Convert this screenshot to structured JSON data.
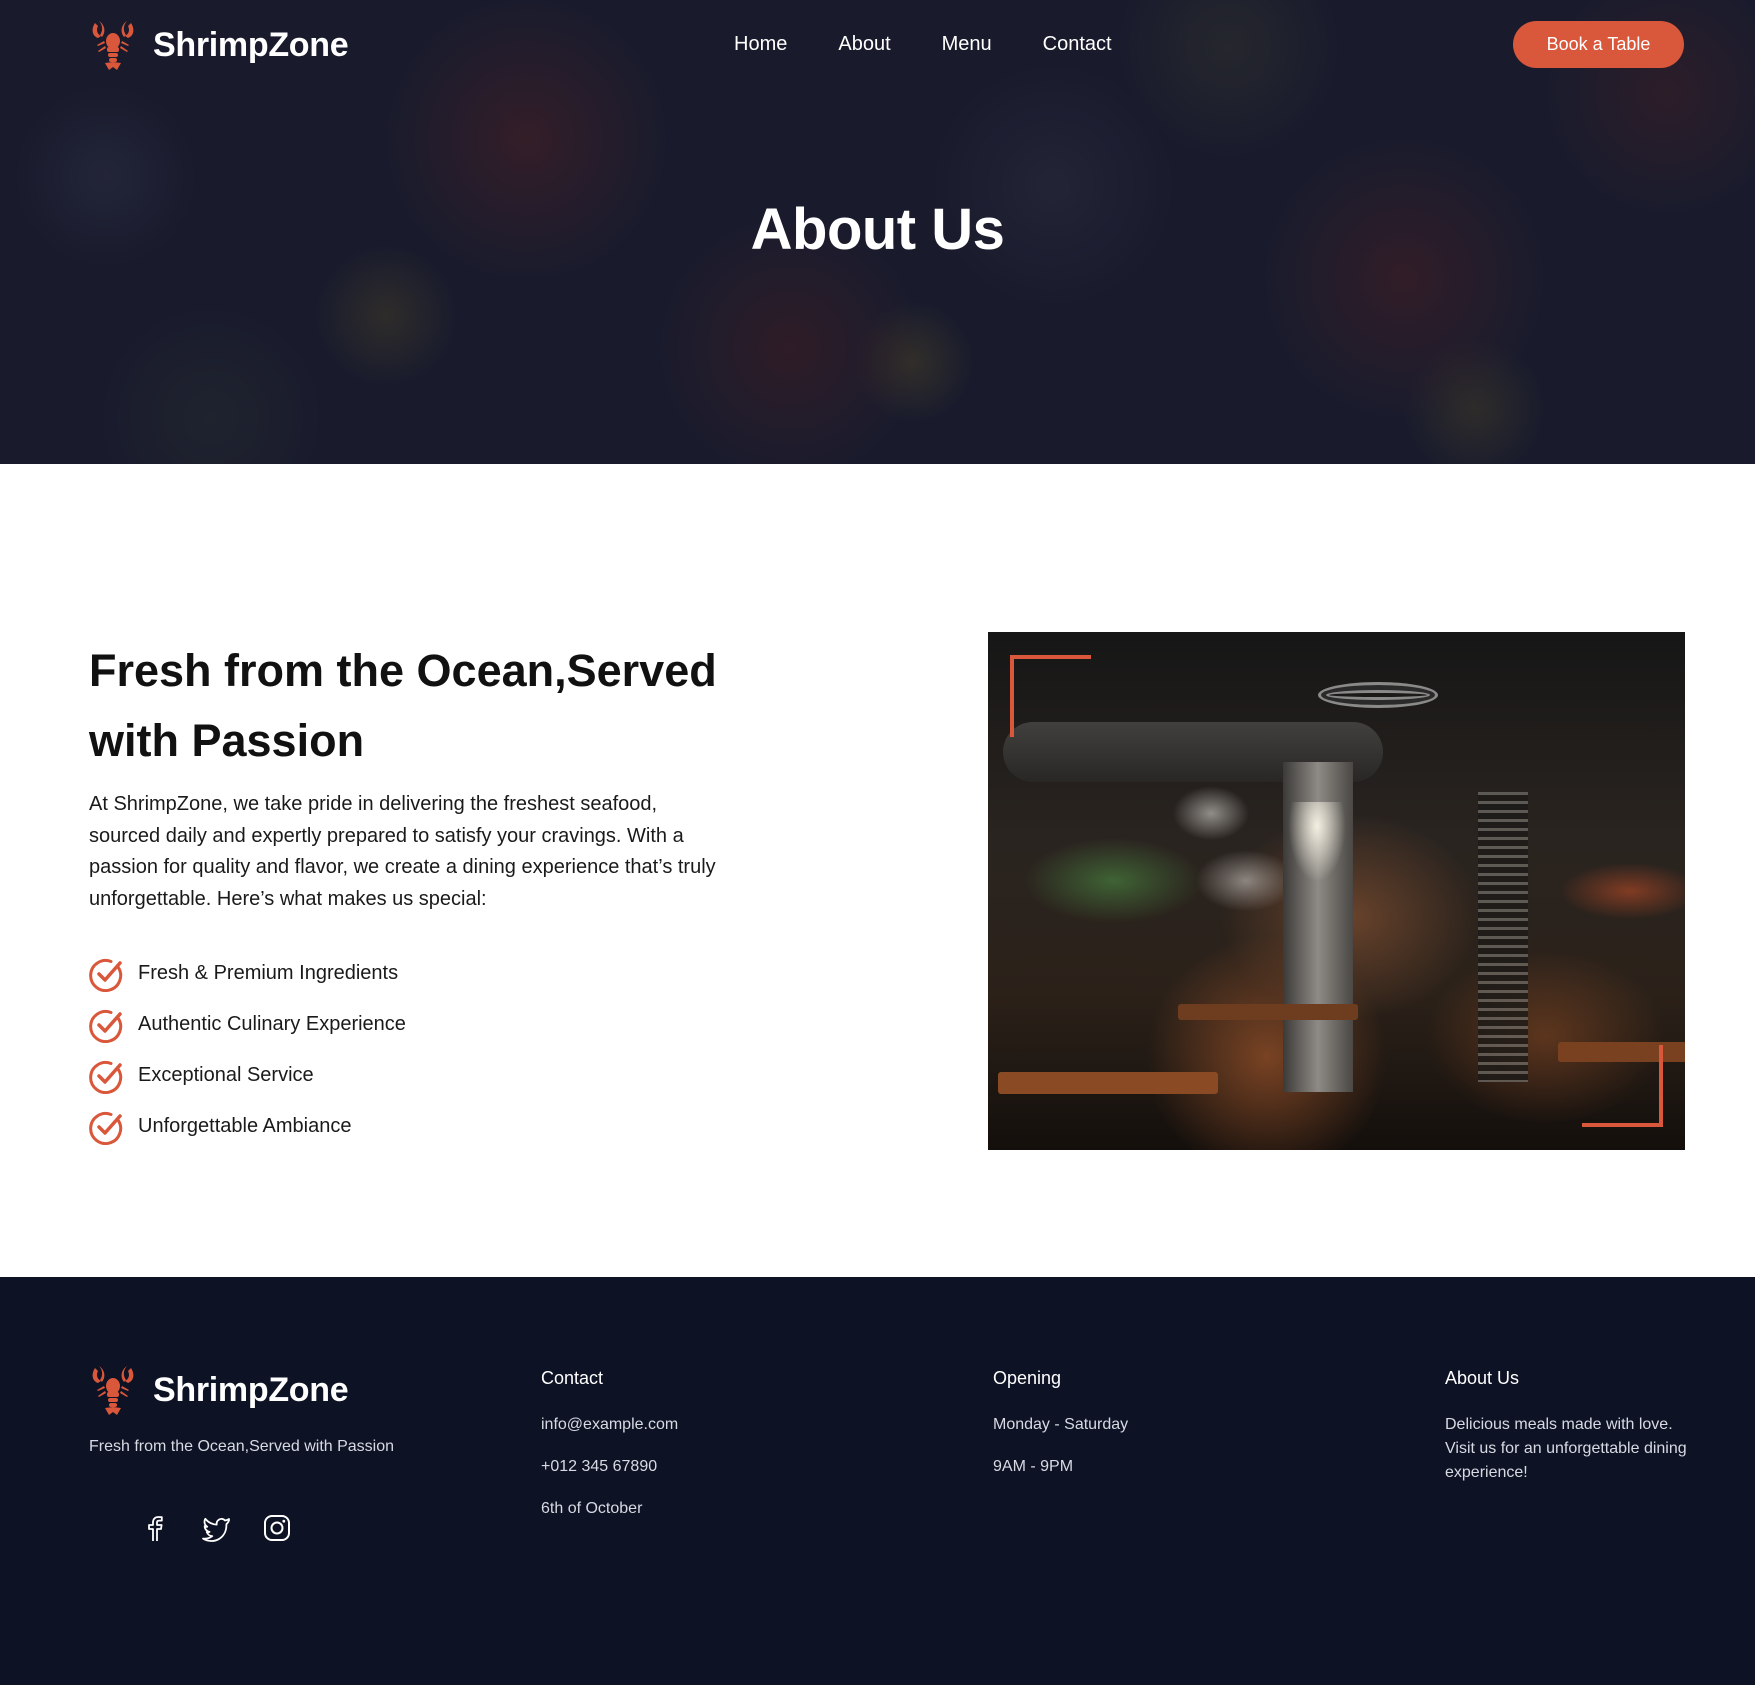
{
  "nav": {
    "brand": "ShrimpZone",
    "links": [
      "Home",
      "About",
      "Menu",
      "Contact"
    ],
    "cta_label": "Book a Table"
  },
  "hero": {
    "title": "About Us"
  },
  "about": {
    "heading": "Fresh from the Ocean,Served with Passion",
    "intro": "At ShrimpZone, we take pride in delivering the freshest seafood, sourced daily and expertly prepared to satisfy your cravings. With a passion for quality and flavor, we create a dining experience that’s truly unforgettable. Here’s what makes us special:",
    "features": [
      "Fresh & Premium Ingredients",
      "Authentic Culinary Experience",
      "Exceptional Service",
      "Unforgettable Ambiance"
    ],
    "image_icon": "restaurant-interior-photo"
  },
  "footer": {
    "brand": "ShrimpZone",
    "tagline": "Fresh from the Ocean,Served with Passion",
    "socials": [
      "facebook-icon",
      "twitter-icon",
      "instagram-icon"
    ],
    "contact": {
      "title": "Contact",
      "email": "info@example.com",
      "phone": "+012 345 67890",
      "address": "6th of October"
    },
    "opening": {
      "title": "Opening",
      "days": "Monday - Saturday",
      "hours": "9AM - 9PM"
    },
    "about": {
      "title": "About Us",
      "text": "Delicious meals made with love. Visit us for an unforgettable dining experience!"
    }
  },
  "colors": {
    "accent": "#d9573a",
    "footer_bg": "#0d1224",
    "hero_overlay": "#1a1c30"
  }
}
